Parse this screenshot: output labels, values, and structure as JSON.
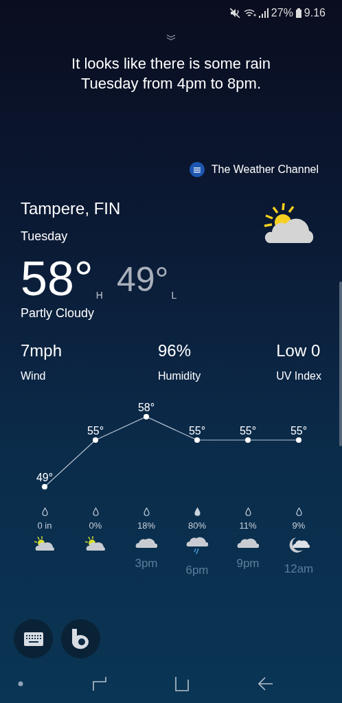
{
  "status_bar": {
    "battery": "27%",
    "time": "9.16"
  },
  "message": "It looks like there is some rain Tuesday from 4pm to 8pm.",
  "source": "The Weather Channel",
  "location": "Tampere, FIN",
  "day": "Tuesday",
  "high": {
    "value": "58°",
    "label": "H"
  },
  "low": {
    "value": "49°",
    "label": "L"
  },
  "condition": "Partly Cloudy",
  "stats": [
    {
      "value": "7mph",
      "label": "Wind"
    },
    {
      "value": "96%",
      "label": "Humidity"
    },
    {
      "value": "Low 0",
      "label": "UV Index"
    }
  ],
  "chart_data": {
    "type": "line",
    "categories": [
      null,
      null,
      null,
      null,
      null,
      null
    ],
    "series": [
      {
        "color": "#b8c4d2",
        "marker": "circle",
        "values": [
          49,
          55,
          58,
          55,
          55,
          55
        ],
        "value_labels": [
          "49°",
          "55°",
          "58°",
          "55°",
          "55°",
          "55°"
        ]
      }
    ]
  },
  "hourly": [
    {
      "precip": "0 in",
      "drop_filled": false,
      "kind": "partly-sunny"
    },
    {
      "precip": "0%",
      "drop_filled": false,
      "kind": "partly-sunny"
    },
    {
      "precip": "18%",
      "drop_filled": false,
      "kind": "cloudy",
      "hour": "3pm"
    },
    {
      "precip": "80%",
      "drop_filled": true,
      "kind": "rain",
      "hour": "6pm"
    },
    {
      "precip": "11%",
      "drop_filled": false,
      "kind": "cloudy",
      "hour": "9pm"
    },
    {
      "precip": "9%",
      "drop_filled": false,
      "kind": "night-cloudy",
      "hour": "12am"
    }
  ]
}
